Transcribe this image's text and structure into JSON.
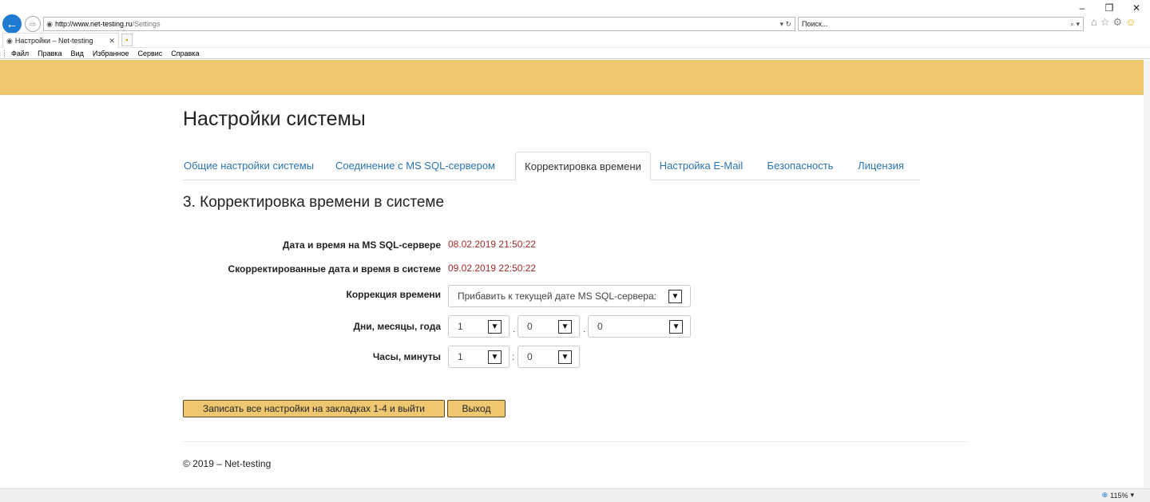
{
  "window": {
    "minimize": "–",
    "restore": "❐",
    "close": "✕"
  },
  "browser": {
    "back_icon": "←",
    "forward_icon": "⇨",
    "address_host": "http://www.net-testing.ru",
    "address_path": "/Settings",
    "address_tools": "▾ ↻",
    "search_placeholder": "Поиск...",
    "search_tools": "⌕ ▾",
    "tab_title": "Настройки – Net-testing",
    "tab_close": "✕",
    "menu": [
      "Файл",
      "Правка",
      "Вид",
      "Избранное",
      "Сервис",
      "Справка"
    ],
    "zoom": "115%",
    "zoom_dropdown": "▾"
  },
  "page": {
    "title": "Настройки системы",
    "tabs": [
      {
        "label": "Общие настройки системы"
      },
      {
        "label": "Соединение с MS SQL-сервером"
      },
      {
        "label": "Корректировка времени"
      },
      {
        "label": "Настройка E-Mail"
      },
      {
        "label": "Безопасность"
      },
      {
        "label": "Лицензия"
      }
    ],
    "active_tab": 2,
    "section_title": "3. Корректировка времени в системе",
    "form": {
      "sql_datetime_label": "Дата и время на MS SQL-сервере",
      "sql_datetime_value": "08.02.2019 21:50:22",
      "corrected_label": "Скорректированные дата и время в системе",
      "corrected_value": "09.02.2019 22:50:22",
      "correction_label": "Коррекция времени",
      "correction_value": "Прибавить к текущей дате MS SQL-сервера:",
      "dmy_label": "Дни, месяцы, года",
      "days_value": "1",
      "months_value": "0",
      "years_value": "0",
      "dot_sep": ".",
      "hm_label": "Часы, минуты",
      "hours_value": "1",
      "minutes_value": "0",
      "colon_sep": ":"
    },
    "buttons": {
      "save_label": "Записать все настройки на закладках 1-4 и выйти",
      "exit_label": "Выход"
    },
    "footer": "© 2019 – Net-testing"
  },
  "colors": {
    "banner": "#efc771",
    "link": "#2a75b5",
    "value": "#a52a2a"
  }
}
